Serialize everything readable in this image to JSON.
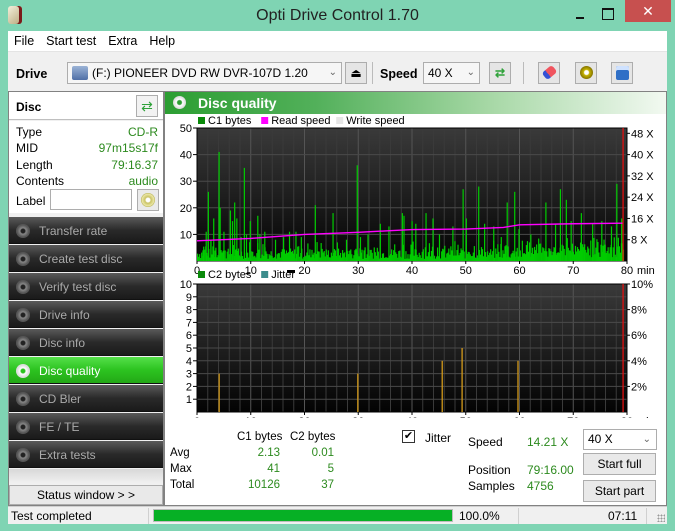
{
  "window": {
    "title": "Opti Drive Control 1.70",
    "close_glyph": "✕"
  },
  "menu": [
    "File",
    "Start test",
    "Extra",
    "Help"
  ],
  "toolbar": {
    "drive_label": "Drive",
    "drive_value": "(F:)  PIONEER DVD RW  DVR-107D 1.20",
    "speed_label": "Speed",
    "speed_value": "40 X",
    "eject_glyph": "⏏",
    "refresh_glyph": "⇄",
    "icons": [
      "eject-icon",
      "refresh-icon",
      "eraser-icon",
      "settings-icon",
      "save-icon"
    ]
  },
  "disc": {
    "header": "Disc",
    "fields": [
      {
        "key": "Type",
        "value": "CD-R"
      },
      {
        "key": "MID",
        "value": "97m15s17f"
      },
      {
        "key": "Length",
        "value": "79:16.37"
      },
      {
        "key": "Contents",
        "value": "audio"
      }
    ],
    "label_key": "Label",
    "label_value": ""
  },
  "nav": [
    {
      "label": "Transfer rate",
      "active": false
    },
    {
      "label": "Create test disc",
      "active": false
    },
    {
      "label": "Verify test disc",
      "active": false
    },
    {
      "label": "Drive info",
      "active": false
    },
    {
      "label": "Disc info",
      "active": false
    },
    {
      "label": "Disc quality",
      "active": true
    },
    {
      "label": "CD Bler",
      "active": false
    },
    {
      "label": "FE / TE",
      "active": false
    },
    {
      "label": "Extra tests",
      "active": false
    }
  ],
  "status_window_btn": "Status window > >",
  "panel": {
    "title": "Disc quality"
  },
  "chart_data": [
    {
      "type": "bar",
      "title": "C1 bytes / Read speed",
      "legend": [
        {
          "name": "C1 bytes",
          "color": "#0a8a0a"
        },
        {
          "name": "Read speed",
          "color": "#ff00ff"
        },
        {
          "name": "Write speed",
          "color": "#e6e6e6"
        }
      ],
      "legend_position": "top-left",
      "xlabel": "min",
      "x_range": [
        0,
        80
      ],
      "x_ticks": [
        "0",
        "10",
        "20",
        "30",
        "40",
        "50",
        "60",
        "70",
        "80"
      ],
      "y_range": [
        0,
        50
      ],
      "y_ticks": [
        "10",
        "20",
        "30",
        "40",
        "50"
      ],
      "y2_ticks": [
        "8 X",
        "16 X",
        "24 X",
        "32 X",
        "40 X",
        "48 X"
      ],
      "y2_range": [
        0,
        50
      ],
      "grid": true,
      "end_marker_min": 79.27,
      "c1_spikes": [
        {
          "x": 1.0,
          "y": 4
        },
        {
          "x": 1.6,
          "y": 11
        },
        {
          "x": 2.0,
          "y": 26
        },
        {
          "x": 2.5,
          "y": 8
        },
        {
          "x": 3.0,
          "y": 16
        },
        {
          "x": 3.4,
          "y": 5
        },
        {
          "x": 4.0,
          "y": 41
        },
        {
          "x": 4.2,
          "y": 20
        },
        {
          "x": 4.9,
          "y": 11
        },
        {
          "x": 6.1,
          "y": 19
        },
        {
          "x": 6.5,
          "y": 15
        },
        {
          "x": 6.9,
          "y": 22
        },
        {
          "x": 7.3,
          "y": 16
        },
        {
          "x": 8.1,
          "y": 9
        },
        {
          "x": 8.7,
          "y": 35
        },
        {
          "x": 9.1,
          "y": 10
        },
        {
          "x": 9.8,
          "y": 15
        },
        {
          "x": 11.2,
          "y": 17
        },
        {
          "x": 11.6,
          "y": 10
        },
        {
          "x": 12.5,
          "y": 11
        },
        {
          "x": 14.5,
          "y": 8
        },
        {
          "x": 16.0,
          "y": 9
        },
        {
          "x": 17.1,
          "y": 11
        },
        {
          "x": 18.3,
          "y": 11
        },
        {
          "x": 19.3,
          "y": 9
        },
        {
          "x": 21.9,
          "y": 21
        },
        {
          "x": 25.2,
          "y": 18
        },
        {
          "x": 26.0,
          "y": 7
        },
        {
          "x": 27.7,
          "y": 8
        },
        {
          "x": 29.7,
          "y": 36
        },
        {
          "x": 30.3,
          "y": 9
        },
        {
          "x": 31.7,
          "y": 10
        },
        {
          "x": 34.0,
          "y": 14
        },
        {
          "x": 35.6,
          "y": 13
        },
        {
          "x": 38.1,
          "y": 18
        },
        {
          "x": 38.4,
          "y": 17
        },
        {
          "x": 39.9,
          "y": 15
        },
        {
          "x": 40.6,
          "y": 14
        },
        {
          "x": 42.5,
          "y": 18
        },
        {
          "x": 43.8,
          "y": 16
        },
        {
          "x": 45.0,
          "y": 10
        },
        {
          "x": 47.5,
          "y": 13
        },
        {
          "x": 49.4,
          "y": 27
        },
        {
          "x": 50.0,
          "y": 16
        },
        {
          "x": 52.3,
          "y": 28
        },
        {
          "x": 53.4,
          "y": 14
        },
        {
          "x": 55.1,
          "y": 13
        },
        {
          "x": 56.5,
          "y": 9
        },
        {
          "x": 57.6,
          "y": 22
        },
        {
          "x": 59.0,
          "y": 26
        },
        {
          "x": 59.8,
          "y": 12
        },
        {
          "x": 62.0,
          "y": 10
        },
        {
          "x": 64.8,
          "y": 22
        },
        {
          "x": 66.6,
          "y": 14
        },
        {
          "x": 67.5,
          "y": 27
        },
        {
          "x": 68.6,
          "y": 23
        },
        {
          "x": 69.5,
          "y": 15
        },
        {
          "x": 71.4,
          "y": 18
        },
        {
          "x": 73.5,
          "y": 14
        },
        {
          "x": 75.2,
          "y": 15
        },
        {
          "x": 77.0,
          "y": 13
        },
        {
          "x": 78.0,
          "y": 29
        },
        {
          "x": 78.9,
          "y": 16
        }
      ],
      "c1_baseline_note": "dense bars mostly 1-6 bytes across full disc",
      "read_speed_x": [
        0,
        10,
        20,
        30,
        35,
        40,
        50,
        57,
        60,
        70,
        79.3
      ],
      "read_speed_values": [
        7.6,
        8.5,
        10.0,
        10.8,
        11.3,
        11.8,
        12.0,
        12.6,
        13.6,
        14.0,
        14.2
      ]
    },
    {
      "type": "bar",
      "title": "C2 bytes / Jitter",
      "legend": [
        {
          "name": "C2 bytes",
          "color": "#0a8a0a"
        },
        {
          "name": "Jitter",
          "color": "#3c8c8c"
        }
      ],
      "legend_position": "top-left",
      "xlabel": "min",
      "x_range": [
        0,
        80
      ],
      "x_ticks": [
        "0",
        "10",
        "20",
        "30",
        "40",
        "50",
        "60",
        "70",
        "80"
      ],
      "y_range": [
        0,
        10
      ],
      "y_ticks": [
        "1",
        "2",
        "3",
        "4",
        "5",
        "6",
        "7",
        "8",
        "9",
        "10"
      ],
      "y2_ticks": [
        "2%",
        "4%",
        "6%",
        "8%",
        "10%"
      ],
      "y2_range": [
        0,
        10
      ],
      "grid": true,
      "end_marker_min": 79.27,
      "c2_bars": [
        {
          "x": 4.0,
          "y": 3
        },
        {
          "x": 29.8,
          "y": 3
        },
        {
          "x": 45.5,
          "y": 4
        },
        {
          "x": 49.2,
          "y": 5
        },
        {
          "x": 59.6,
          "y": 4
        }
      ]
    }
  ],
  "stats": {
    "col_c1": "C1 bytes",
    "col_c2": "C2 bytes",
    "rows": [
      {
        "label": "Avg",
        "c1": "2.13",
        "c2": "0.01"
      },
      {
        "label": "Max",
        "c1": "41",
        "c2": "5"
      },
      {
        "label": "Total",
        "c1": "10126",
        "c2": "37"
      }
    ],
    "jitter_label": "Jitter",
    "jitter_checked": true,
    "check_glyph": "✔"
  },
  "readout": {
    "speed_label": "Speed",
    "speed_value": "14.21 X",
    "position_label": "Position",
    "position_value": "79:16.00",
    "samples_label": "Samples",
    "samples_value": "4756",
    "speed_select": "40 X",
    "start_full": "Start full",
    "start_part": "Start part"
  },
  "statusbar": {
    "text": "Test completed",
    "progress_percent": 100,
    "progress_text": "100.0%",
    "elapsed": "07:11"
  },
  "colors": {
    "accent": "#2cc320",
    "value_green": "#2c8a1e",
    "c1": "#00cc00",
    "read_speed": "#ff00ff",
    "c2": "#d39a1b",
    "end_marker": "#e01010",
    "progress": "#06b025"
  }
}
